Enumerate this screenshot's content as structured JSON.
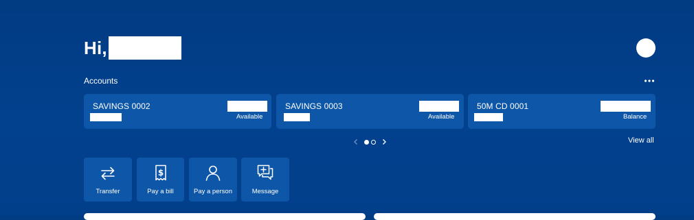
{
  "greeting": {
    "prefix": "Hi,"
  },
  "accounts": {
    "label": "Accounts",
    "more_icon": "more-horizontal-icon",
    "cards": [
      {
        "name": "SAVINGS 0002",
        "status": "Available"
      },
      {
        "name": "SAVINGS 0003",
        "status": "Available"
      },
      {
        "name": "50M CD 0001",
        "status": "Balance"
      }
    ]
  },
  "pager": {
    "current_page": 1,
    "total_pages": 2,
    "prev_icon": "chevron-left-icon",
    "next_icon": "chevron-right-icon"
  },
  "view_all": {
    "label": "View all"
  },
  "actions": [
    {
      "label": "Transfer",
      "icon": "transfer-arrows-icon"
    },
    {
      "label": "Pay a bill",
      "icon": "dollar-receipt-icon"
    },
    {
      "label": "Pay a person",
      "icon": "person-icon"
    },
    {
      "label": "Message",
      "icon": "message-plus-icon"
    }
  ],
  "colors": {
    "background": "#013b82",
    "card_background": "#0e57a8",
    "text": "#ffffff"
  }
}
